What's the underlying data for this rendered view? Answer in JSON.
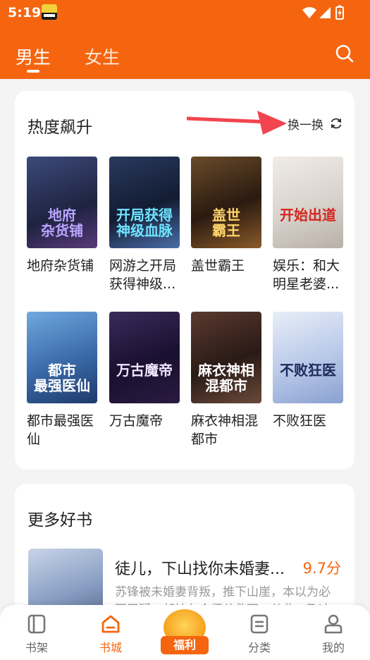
{
  "status_bar": {
    "time": "5:19"
  },
  "tabs": {
    "male": "男生",
    "female": "女生"
  },
  "hot": {
    "title": "热度飙升",
    "refresh_label": "换一换",
    "books": [
      {
        "title": "地府杂货铺",
        "cover_text": "地府\n杂货铺",
        "bg": "linear-gradient(160deg,#3c4a7a 0%,#1e2340 60%,#5a3a7a 100%)",
        "fg": "#b9a4ff"
      },
      {
        "title": "网游之开局获得神级...",
        "cover_text": "开局获得\n神级血脉",
        "bg": "linear-gradient(160deg,#2a3a5e 0%,#121c33 55%,#4a6ea8 100%)",
        "fg": "#6fe3ff"
      },
      {
        "title": "盖世霸王",
        "cover_text": "盖世\n霸王",
        "bg": "linear-gradient(160deg,#6a4b2a 0%,#2a1a10 55%,#8a5a2a 100%)",
        "fg": "#ffd36a"
      },
      {
        "title": "娱乐：和大明星老婆...",
        "cover_text": "开始出道",
        "bg": "linear-gradient(160deg,#f0ece6 0%,#d8d2cc 55%,#b8b0a8 100%)",
        "fg": "#d4271e"
      },
      {
        "title": "都市最强医仙",
        "cover_text": "都市\n最强医仙",
        "bg": "linear-gradient(160deg,#6fa8e0 0%,#3a6aa8 55%,#1e3a6a 100%)",
        "fg": "#ffffff"
      },
      {
        "title": "万古魔帝",
        "cover_text": "万古魔帝",
        "bg": "linear-gradient(160deg,#3a2a5a 0%,#1a1030 55%,#2a1a40 100%)",
        "fg": "#f0e6ff"
      },
      {
        "title": "麻衣神相混都市",
        "cover_text": "麻衣神相\n混都市",
        "bg": "linear-gradient(160deg,#5a3a30 0%,#2a1a16 55%,#6a4a3a 100%)",
        "fg": "#ffffff"
      },
      {
        "title": "不败狂医",
        "cover_text": "不败狂医",
        "bg": "linear-gradient(160deg,#e8eef8 0%,#b8c8e8 55%,#8aa0d0 100%)",
        "fg": "#1a2a5a"
      }
    ]
  },
  "more": {
    "title": "更多好书",
    "featured": {
      "title": "徒儿，下山找你未婚妻...",
      "score": "9.7分",
      "desc": "苏锋被未婚妻背叛，推下山崖，本以为必死无疑，却被七个师父救下，从此一飞冲"
    }
  },
  "nav": {
    "shelf": "书架",
    "store": "书城",
    "welfare": "福利",
    "category": "分类",
    "mine": "我的"
  },
  "colors": {
    "accent": "#f5650f"
  }
}
